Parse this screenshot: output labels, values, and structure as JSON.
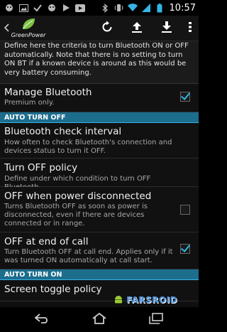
{
  "status_bar": {
    "time": "10:57",
    "icons_left": [
      "android-debug-icon",
      "image-icon",
      "check-icon",
      "android-debug-icon",
      "play-icon",
      "youtube-icon"
    ],
    "icons_right": [
      "bluetooth-icon",
      "vibrate-icon",
      "wifi-icon",
      "signal-icon",
      "battery-icon"
    ]
  },
  "action_bar": {
    "app_name": "GreenPower",
    "actions": [
      "refresh-icon",
      "upload-icon",
      "download-icon",
      "overflow-menu-icon"
    ]
  },
  "intro_text": "Define here the criteria to turn Bluetooth ON or OFF automatically. Note that there is no setting to turn ON BT if a known device is around as this would be very battery consuming.",
  "prefs": {
    "manage_bluetooth": {
      "title": "Manage Bluetooth",
      "summary": "Premium only.",
      "checked": true
    },
    "section_auto_off": "AUTO TURN OFF",
    "check_interval": {
      "title": "Bluetooth check interval",
      "summary": "How often to check Bluetooth's connection and devices status to turn it OFF."
    },
    "off_policy": {
      "title": "Turn OFF policy",
      "summary": "Define under which condition to turn OFF Bluetooth."
    },
    "off_power_disconnected": {
      "title": "OFF when power disconnected",
      "summary": "Turns Bluetooth OFF as soon as power is disconnected, even if there are devices connected or in range.",
      "checked": false
    },
    "off_end_call": {
      "title": "OFF at end of call",
      "summary": "Turn Bluetooth OFF at call end. Applies only if it was turned ON automatically at call start.",
      "checked": true
    },
    "section_auto_on": "AUTO TURN ON",
    "screen_toggle": {
      "title": "Screen toggle policy"
    }
  },
  "watermark": {
    "text": "FARSROID"
  },
  "nav_bar": [
    "back-icon",
    "home-icon",
    "recent-apps-icon"
  ],
  "colors": {
    "accent": "#33b5e5",
    "section_bg": "#1d6d8d",
    "logo_green": "#7ac142"
  }
}
